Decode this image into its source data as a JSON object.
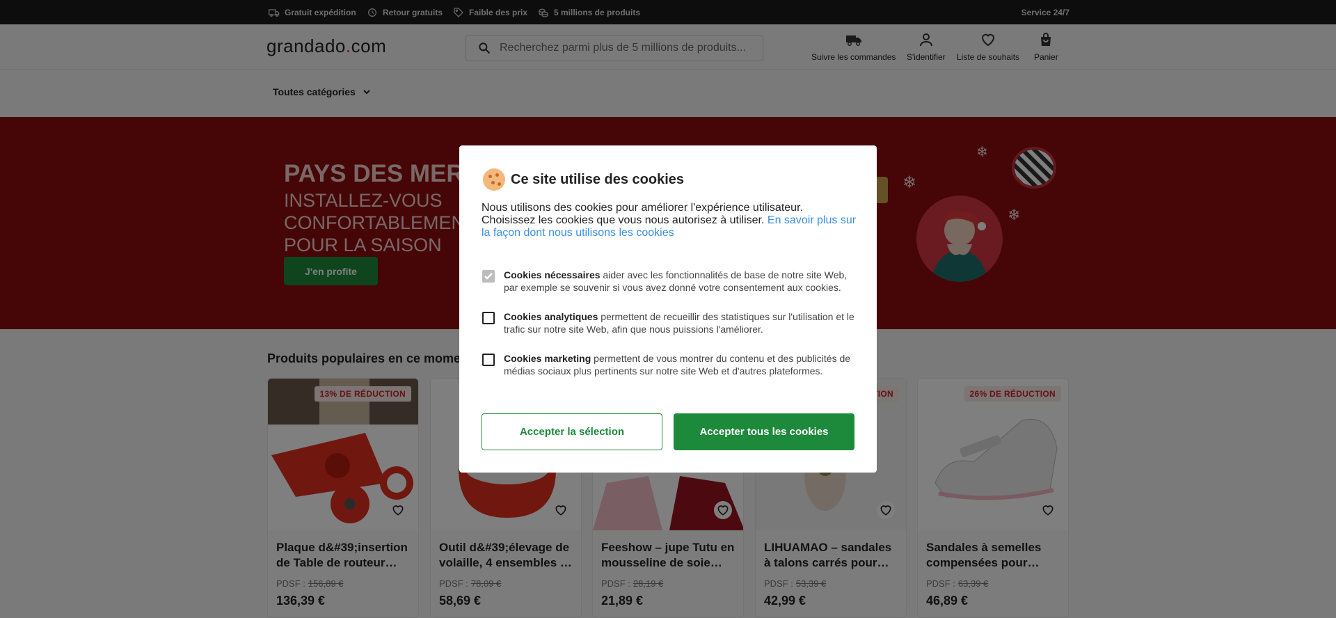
{
  "topbar": {
    "usps": [
      {
        "icon": "truck-icon",
        "label": "Gratuit expédition"
      },
      {
        "icon": "return-icon",
        "label": "Retour gratuits"
      },
      {
        "icon": "tag-icon",
        "label": "Faible des prix"
      },
      {
        "icon": "coins-icon",
        "label": "5 millions de produits"
      }
    ],
    "service": "Service 24/7"
  },
  "header": {
    "logo_text": "grandado",
    "logo_dot": ".",
    "logo_tld": "com",
    "search_placeholder": "Recherchez parmi plus de 5 millions de produits...",
    "actions": [
      {
        "icon": "truck-icon",
        "label": "Suivre les commandes"
      },
      {
        "icon": "user-icon",
        "label": "S'identifier"
      },
      {
        "icon": "heart-icon",
        "label": "Liste de souhaits"
      },
      {
        "icon": "bag-icon",
        "label": "Panier"
      }
    ]
  },
  "nav": {
    "categories_label": "Toutes catégories"
  },
  "hero": {
    "headline": "PAYS DES MERVEILLES",
    "subline": "INSTALLEZ-VOUS CONFORTABLEMENT POUR LA SAISON",
    "cta": "J'en profite"
  },
  "products": {
    "section_title": "Produits populaires en ce moment",
    "pdsf_label": "PDSF :",
    "items": [
      {
        "badge": "13% DE RÉDUCTION",
        "title": "Plaque d&#39;insertion de Table de routeur…",
        "old_price": "156,89 €",
        "price": "136,39 €"
      },
      {
        "badge": "",
        "title": "Outil d&#39;élevage de volaille, 4 ensembles …",
        "old_price": "78,09 €",
        "price": "58,69 €"
      },
      {
        "badge": "",
        "title": "Feeshow – jupe Tutu en mousseline de soie…",
        "old_price": "28,19 €",
        "price": "21,89 €"
      },
      {
        "badge": "20% DE RÉDUCTION",
        "title": "LIHUAMAO – sandales à talons carrés pour…",
        "old_price": "53,39 €",
        "price": "42,99 €"
      },
      {
        "badge": "26% DE RÉDUCTION",
        "title": "Sandales à semelles compensées pour…",
        "old_price": "63,39 €",
        "price": "46,89 €"
      }
    ]
  },
  "cookie_modal": {
    "title": "Ce site utilise des cookies",
    "intro": "Nous utilisons des cookies pour améliorer l'expérience utilisateur. Choisissez les cookies que vous nous autorisez à utiliser.",
    "link": "En savoir plus sur la façon dont nous utilisons les cookies",
    "options": [
      {
        "name": "Cookies nécessaires",
        "desc": "aider avec les fonctionnalités de base de notre site Web, par exemple se souvenir si vous avez donné votre consentement aux cookies.",
        "checked": true
      },
      {
        "name": "Cookies analytiques",
        "desc": "permettent de recueillir des statistiques sur l'utilisation et le trafic sur notre site Web, afin que nous puissions l'améliorer.",
        "checked": false
      },
      {
        "name": "Cookies marketing",
        "desc": "permettent de vous montrer du contenu et des publicités de médias sociaux plus pertinents sur notre site Web et d'autres plateformes.",
        "checked": false
      }
    ],
    "accept_selection": "Accepter la sélection",
    "accept_all": "Accepter tous les cookies"
  },
  "colors": {
    "brand_green": "#1c8a3a",
    "hero_red": "#8c0a0c",
    "discount_red": "#c8262c",
    "link_blue": "#3a8ee6"
  }
}
